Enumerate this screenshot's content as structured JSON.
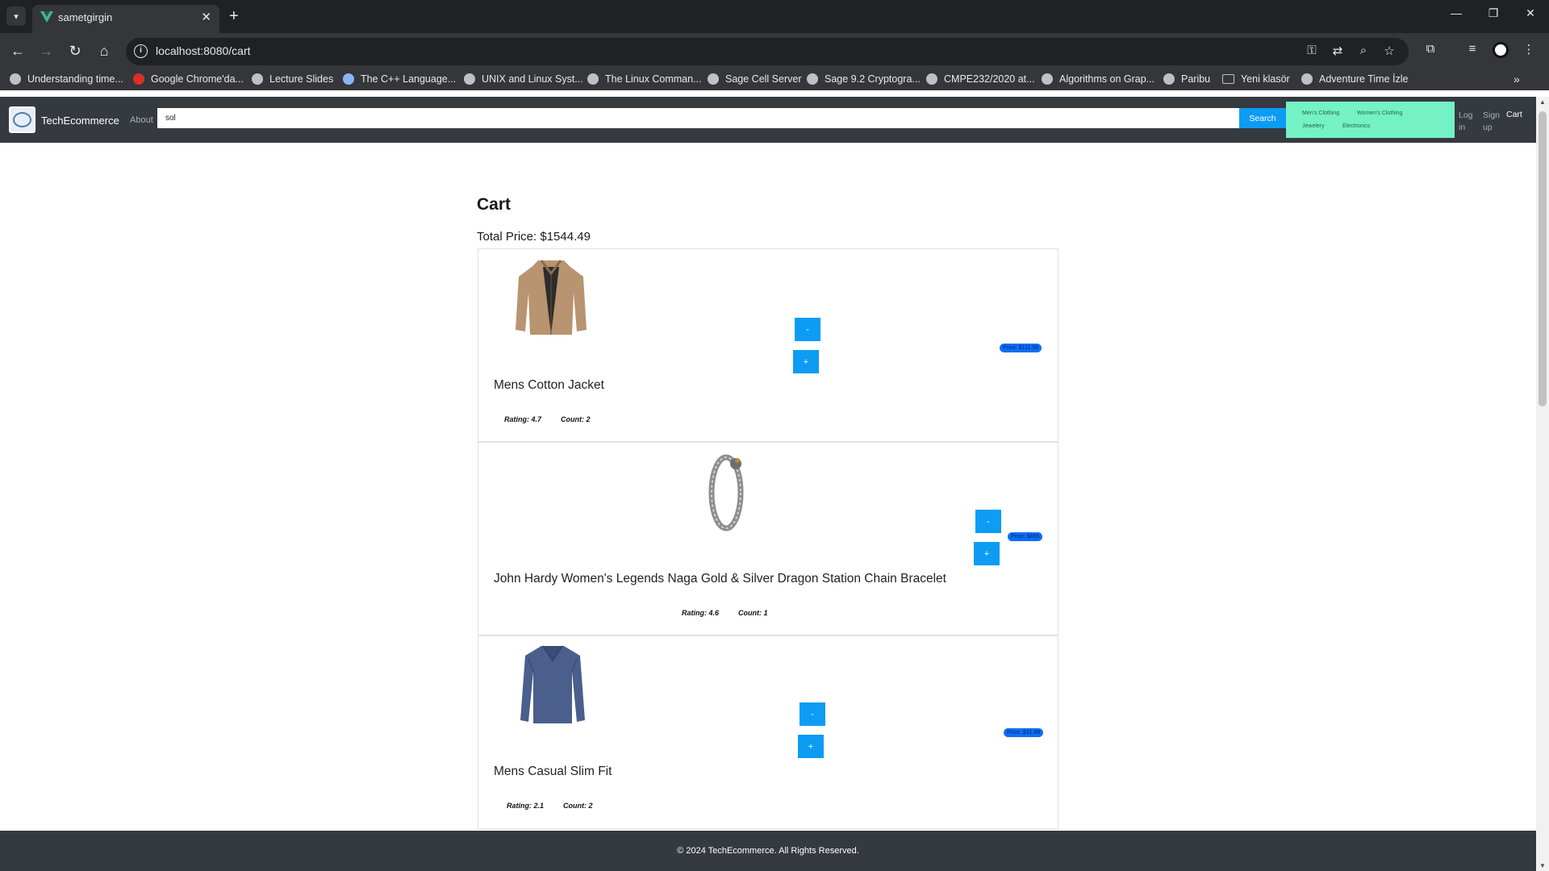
{
  "browser": {
    "tab_title": "sametgirgin",
    "url": "localhost:8080/cart",
    "bookmarks": [
      {
        "label": "Understanding time...",
        "icon": "globe-icon"
      },
      {
        "label": "Google Chrome'da...",
        "icon": "chrome-icon"
      },
      {
        "label": "Lecture Slides",
        "icon": "globe-icon"
      },
      {
        "label": "The C++ Language...",
        "icon": "globe-icon"
      },
      {
        "label": "UNIX and Linux Syst...",
        "icon": "globe-icon"
      },
      {
        "label": "The Linux Comman...",
        "icon": "globe-icon"
      },
      {
        "label": "Sage Cell Server",
        "icon": "globe-icon"
      },
      {
        "label": "Sage 9.2 Cryptogra...",
        "icon": "globe-icon"
      },
      {
        "label": "CMPE232/2020 at...",
        "icon": "globe-icon"
      },
      {
        "label": "Algorithms on Grap...",
        "icon": "globe-icon"
      },
      {
        "label": "Paribu",
        "icon": "globe-icon"
      },
      {
        "label": "Yeni klasör",
        "icon": "folder-icon"
      },
      {
        "label": "Adventure Time İzle",
        "icon": "globe-icon"
      }
    ]
  },
  "site": {
    "brand": "TechEcommerce",
    "about": "About",
    "search_value": "sol",
    "search_button": "Search",
    "categories": [
      "Men's Clothing",
      "Women's Clothing",
      "Jewelery",
      "Electronics"
    ],
    "login": "Log in",
    "signup": "Sign up",
    "cart": "Cart"
  },
  "cart": {
    "title": "Cart",
    "total": "Total Price: $1544.49",
    "minus_label": "-",
    "plus_label": "+",
    "items": [
      {
        "name": "Mens Cotton Jacket",
        "rating": "Rating: 4.7",
        "count": "Count: 2",
        "price": "Price: $111.98"
      },
      {
        "name": "John Hardy Women's Legends Naga Gold & Silver Dragon Station Chain Bracelet",
        "rating": "Rating: 4.6",
        "count": "Count: 1",
        "price": "Price: $695"
      },
      {
        "name": "Mens Casual Slim Fit",
        "rating": "Rating: 2.1",
        "count": "Count: 2",
        "price": "Price: $31.98"
      }
    ]
  },
  "footer": {
    "text": "© 2024 TechEcommerce. All Rights Reserved."
  },
  "colors": {
    "nav_bg": "#343a40",
    "accent_blue": "#0d9cf3",
    "category_bg": "#74f2c6",
    "price_badge": "#0d6ef7"
  }
}
